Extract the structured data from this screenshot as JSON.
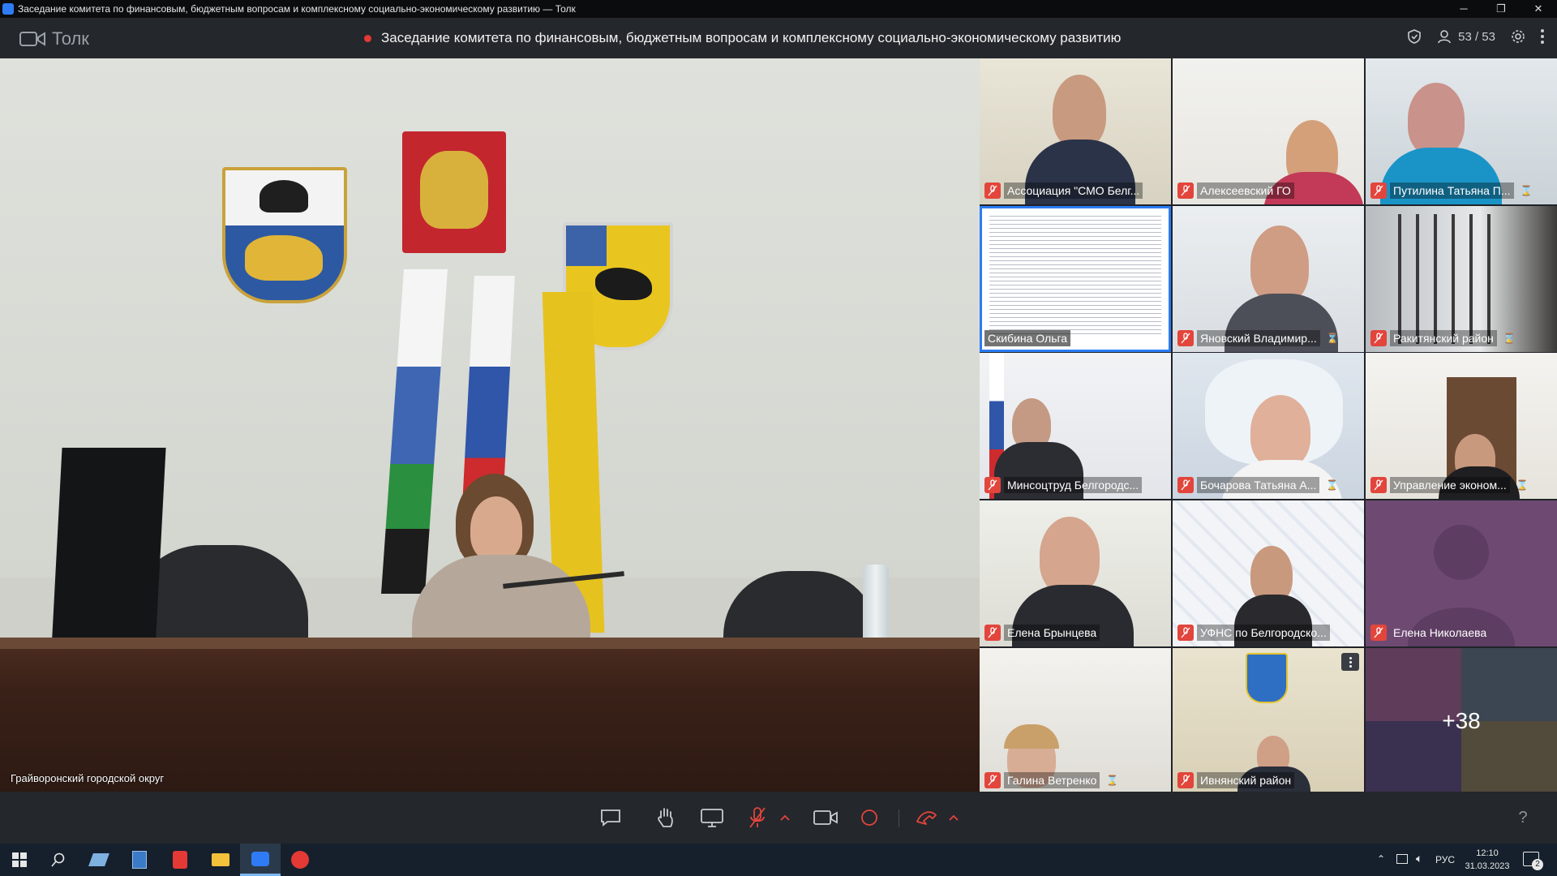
{
  "window": {
    "title": "Заседание комитета по финансовым, бюджетным вопросам и комплексному социально-экономическому развитию — Толк"
  },
  "header": {
    "brand": "Толк",
    "meeting_title": "Заседание комитета по финансовым, бюджетным вопросам и комплексному социально-экономическому развитию",
    "participants_count": "53 / 53"
  },
  "main_video": {
    "label": "Грайворонский городской округ"
  },
  "participants": [
    {
      "name": "Ассоциация \"СМО Белг...",
      "timer": ""
    },
    {
      "name": "Алексеевский ГО",
      "timer": ""
    },
    {
      "name": "Путилина Татьяна П...",
      "timer": "⌛"
    },
    {
      "name": "Скибина Ольга",
      "timer": ""
    },
    {
      "name": "Яновский Владимир...",
      "timer": "⌛"
    },
    {
      "name": "Ракитянский район",
      "timer": "⌛"
    },
    {
      "name": "Минсоцтруд Белгородс...",
      "timer": ""
    },
    {
      "name": "Бочарова Татьяна А...",
      "timer": "⌛"
    },
    {
      "name": "Управление эконом...",
      "timer": "⌛"
    },
    {
      "name": "Елена Брынцева",
      "timer": ""
    },
    {
      "name": "УФНС по Белгородско...",
      "timer": ""
    },
    {
      "name": "Елена Николаева",
      "timer": ""
    },
    {
      "name": "Галина Ветренко",
      "timer": "⌛"
    },
    {
      "name": "Ивнянский район",
      "timer": ""
    }
  ],
  "more_participants": "+38",
  "toolbar": {
    "help": "?"
  },
  "taskbar": {
    "lang": "РУС",
    "time": "12:10",
    "date": "31.03.2023",
    "notifications": "2"
  }
}
